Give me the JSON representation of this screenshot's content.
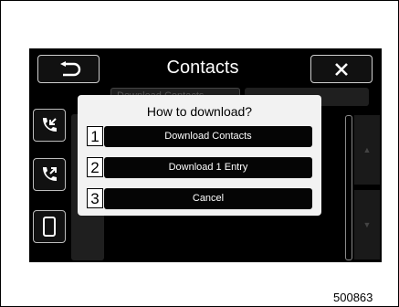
{
  "header": {
    "title": "Contacts"
  },
  "dialog": {
    "title": "How to download?",
    "options": [
      {
        "number": "1",
        "label": "Download Contacts"
      },
      {
        "number": "2",
        "label": "Download 1 Entry"
      },
      {
        "number": "3",
        "label": "Cancel"
      }
    ]
  },
  "background": {
    "tab_label": "Download Contacts"
  },
  "figure_code": "500863",
  "icons": {
    "back": "back-arrow-icon",
    "close": "close-x-icon",
    "incoming_calls": "incoming-call-icon",
    "outgoing_calls": "outgoing-call-icon",
    "phone": "mobile-phone-icon"
  },
  "colors": {
    "screen": "#000000",
    "dialog": "#f2f2f2",
    "button": "#050505"
  }
}
